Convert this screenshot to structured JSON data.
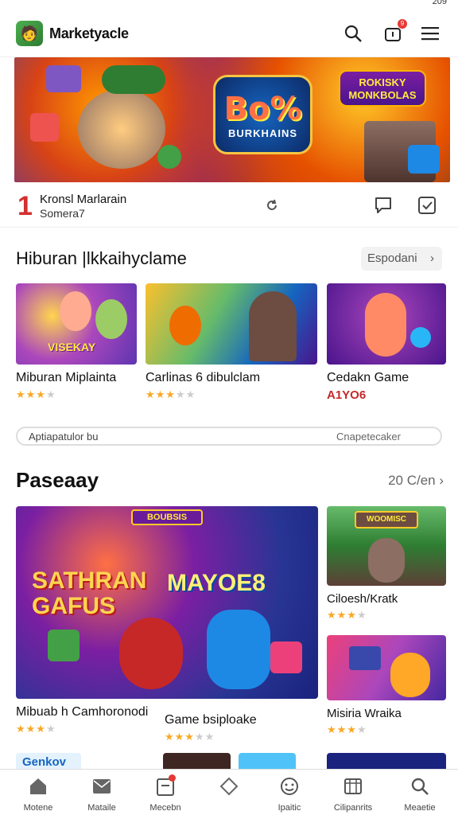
{
  "status": {
    "right": "209"
  },
  "header": {
    "title": "Marketyacle",
    "notification_count": "9"
  },
  "banner": {
    "logo_big": "Bo%",
    "logo_small": "BURKHAINS",
    "sign": "ROKISKY MONKBOLAS"
  },
  "info_row": {
    "rank": "1",
    "title": "Kronsl Marlarain",
    "subtitle": "Somera7"
  },
  "section1": {
    "title": "Hiburan |lkkaihyclame",
    "pill_label": "Espodani",
    "cards": [
      {
        "name": "Miburan Miplainta",
        "thumb_text": "VISEKAY",
        "stars": "★★★",
        "stars_off": "★"
      },
      {
        "name": "Carlinas 6 dibulclam",
        "thumb_text": "",
        "stars": "★★★",
        "stars_off": "★★"
      },
      {
        "name": "Cedakn Game",
        "thumb_text": "",
        "price": "A1YO6"
      }
    ]
  },
  "searchbar": {
    "left": "Aptiapatulor bu",
    "right": "Cnapetecaker"
  },
  "section2": {
    "title": "Paseaay",
    "link": "20 C/en",
    "big_card": {
      "title": "SATHRAN GAFUS",
      "title2": "MAYOE8",
      "sign": "BOUBSIS",
      "name": "Mibuab h Camhoronodi",
      "stars": "★★★",
      "stars_off": "★"
    },
    "mid_card": {
      "name": "Game bsiploake",
      "stars": "★★★",
      "stars_off": "★★"
    },
    "side_cards": [
      {
        "name": "Ciloesh/Kratk",
        "sign": "WOOMISC",
        "stars": "★★★",
        "stars_off": "★"
      },
      {
        "name": "Misiria Wraika",
        "stars": "★★★",
        "stars_off": "★"
      }
    ],
    "peek_label": "Genkov"
  },
  "bottom_nav": [
    {
      "label": "Motene"
    },
    {
      "label": "Mataile"
    },
    {
      "label": "Mecebn"
    },
    {
      "label": ""
    },
    {
      "label": "Ipaitic"
    },
    {
      "label": "Cilipanrits"
    },
    {
      "label": "Meaetie"
    }
  ]
}
